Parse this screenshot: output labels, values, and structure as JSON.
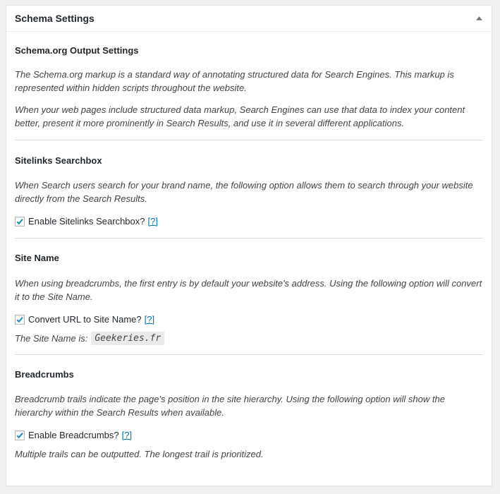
{
  "panel": {
    "title": "Schema Settings"
  },
  "sections": {
    "output": {
      "heading": "Schema.org Output Settings",
      "desc1": "The Schema.org markup is a standard way of annotating structured data for Search Engines. This markup is represented within hidden scripts throughout the website.",
      "desc2": "When your web pages include structured data markup, Search Engines can use that data to index your content better, present it more prominently in Search Results, and use it in several different applications."
    },
    "sitelinks": {
      "heading": "Sitelinks Searchbox",
      "desc": "When Search users search for your brand name, the following option allows them to search through your website directly from the Search Results.",
      "checkbox_label": "Enable Sitelinks Searchbox?",
      "help": "[?]",
      "checked": true
    },
    "sitename": {
      "heading": "Site Name",
      "desc": "When using breadcrumbs, the first entry is by default your website's address. Using the following option will convert it to the Site Name.",
      "checkbox_label": "Convert URL to Site Name?",
      "help": "[?]",
      "checked": true,
      "site_name_label": "The Site Name is:",
      "site_name_value": "Geekeries.fr"
    },
    "breadcrumbs": {
      "heading": "Breadcrumbs",
      "desc": "Breadcrumb trails indicate the page's position in the site hierarchy. Using the following option will show the hierarchy within the Search Results when available.",
      "checkbox_label": "Enable Breadcrumbs?",
      "help": "[?]",
      "checked": true,
      "note": "Multiple trails can be outputted. The longest trail is prioritized."
    }
  },
  "colors": {
    "check": "#1e8cbe",
    "link": "#0073aa"
  }
}
